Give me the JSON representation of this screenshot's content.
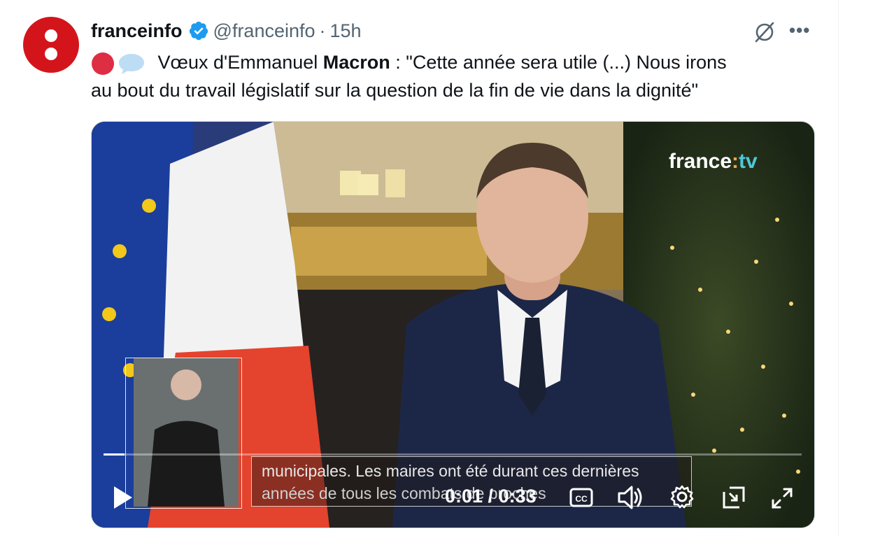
{
  "tweet": {
    "author_name": "franceinfo",
    "handle": "@franceinfo",
    "separator": "·",
    "time": "15h",
    "text_before": "Vœux d'Emmanuel ",
    "text_bold": "Macron",
    "text_line1_after": " : \"Cette année sera utile (...) Nous irons",
    "text_line2": "au bout du travail législatif sur la question de la fin de vie dans la dignité\"",
    "verified_color": "#1d9bf0",
    "emojis": [
      "red-circle-icon",
      "speech-balloon-icon"
    ]
  },
  "video": {
    "logo_main": "france",
    "logo_colon": ":",
    "logo_tv": "tv",
    "caption_line1": "municipales. Les maires ont été durant ces dernières",
    "caption_line2": "années de tous les combats de proches",
    "current_time": "0:01",
    "duration": "0:33",
    "progress": 0.03
  },
  "colors": {
    "brand": "#d3151b",
    "accent": "#1d9bf0",
    "muted": "#536471"
  }
}
